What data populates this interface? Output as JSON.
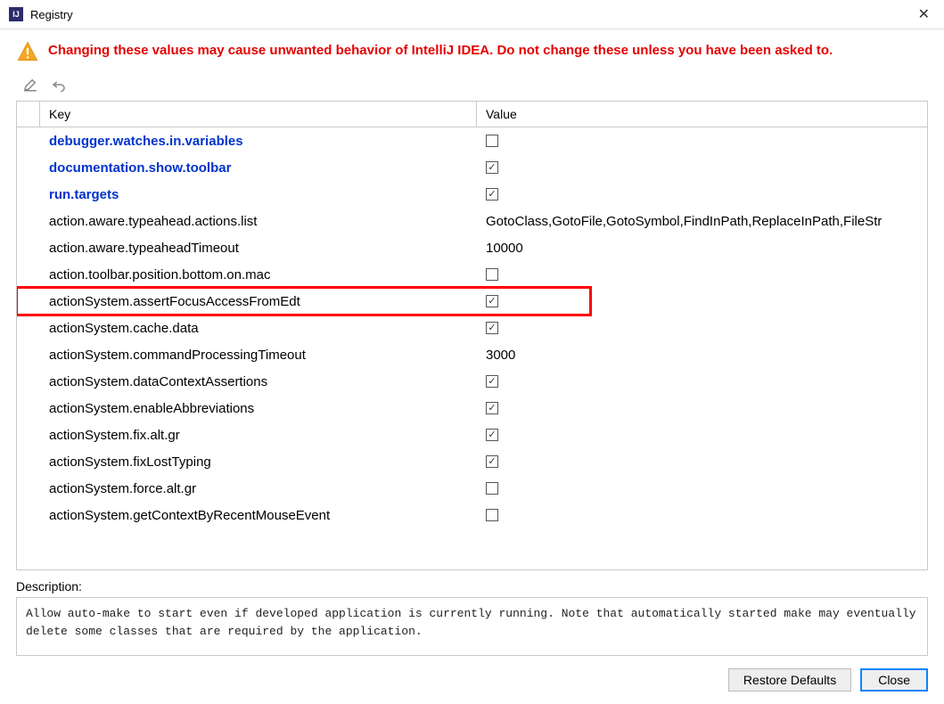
{
  "window": {
    "title": "Registry",
    "close_glyph": "✕"
  },
  "warning": {
    "text": "Changing these values may cause unwanted behavior of IntelliJ IDEA. Do not change these unless you have been asked to."
  },
  "table": {
    "columns": {
      "key": "Key",
      "value": "Value"
    },
    "rows": [
      {
        "key": "debugger.watches.in.variables",
        "bold": true,
        "value_type": "checkbox",
        "checked": false
      },
      {
        "key": "documentation.show.toolbar",
        "bold": true,
        "value_type": "checkbox",
        "checked": true
      },
      {
        "key": "run.targets",
        "bold": true,
        "value_type": "checkbox",
        "checked": true
      },
      {
        "key": "action.aware.typeahead.actions.list",
        "bold": false,
        "value_type": "text",
        "text": "GotoClass,GotoFile,GotoSymbol,FindInPath,ReplaceInPath,FileStr"
      },
      {
        "key": "action.aware.typeaheadTimeout",
        "bold": false,
        "value_type": "text",
        "text": "10000"
      },
      {
        "key": "action.toolbar.position.bottom.on.mac",
        "bold": false,
        "value_type": "checkbox",
        "checked": false
      },
      {
        "key": "actionSystem.assertFocusAccessFromEdt",
        "bold": false,
        "value_type": "checkbox",
        "checked": true,
        "highlighted": true
      },
      {
        "key": "actionSystem.cache.data",
        "bold": false,
        "value_type": "checkbox",
        "checked": true
      },
      {
        "key": "actionSystem.commandProcessingTimeout",
        "bold": false,
        "value_type": "text",
        "text": "3000"
      },
      {
        "key": "actionSystem.dataContextAssertions",
        "bold": false,
        "value_type": "checkbox",
        "checked": true
      },
      {
        "key": "actionSystem.enableAbbreviations",
        "bold": false,
        "value_type": "checkbox",
        "checked": true
      },
      {
        "key": "actionSystem.fix.alt.gr",
        "bold": false,
        "value_type": "checkbox",
        "checked": true
      },
      {
        "key": "actionSystem.fixLostTyping",
        "bold": false,
        "value_type": "checkbox",
        "checked": true
      },
      {
        "key": "actionSystem.force.alt.gr",
        "bold": false,
        "value_type": "checkbox",
        "checked": false
      },
      {
        "key": "actionSystem.getContextByRecentMouseEvent",
        "bold": false,
        "value_type": "checkbox",
        "checked": false
      }
    ]
  },
  "description": {
    "label": "Description:",
    "text": "Allow auto-make to start even if developed application is currently running. Note that automatically started make may eventually delete some classes that are required by the application."
  },
  "buttons": {
    "restore": "Restore Defaults",
    "close": "Close"
  }
}
